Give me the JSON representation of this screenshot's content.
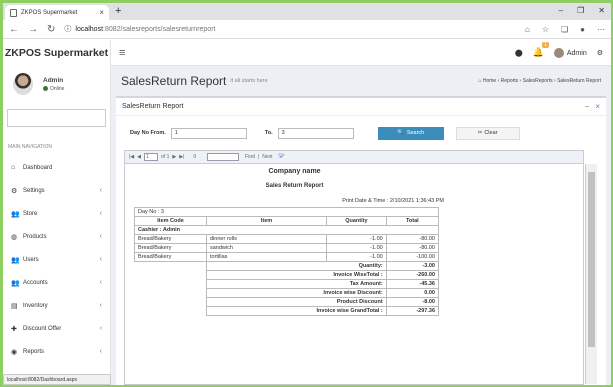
{
  "browser": {
    "tab_title": "ZKPOS Supermarket",
    "url_host": "localhost",
    "url_rest": ":8082/salesreports/salesreturnreport",
    "status_url": "localhost:8082/Dashboard.aspx"
  },
  "app": {
    "brand": "ZKPOS Supermarket",
    "user_name": "Admin",
    "user_status": "Online",
    "topbar_user": "Admin",
    "notification_count": "1"
  },
  "sidebar": {
    "header": "MAIN NAVIGATION",
    "items": [
      {
        "label": "Dashboard",
        "icon": "dashboard-icon"
      },
      {
        "label": "Settings",
        "icon": "gear-icon"
      },
      {
        "label": "Store",
        "icon": "users-icon"
      },
      {
        "label": "Products",
        "icon": "products-icon"
      },
      {
        "label": "Users",
        "icon": "users-icon"
      },
      {
        "label": "Accounts",
        "icon": "users-icon"
      },
      {
        "label": "Inventory",
        "icon": "inventory-icon"
      },
      {
        "label": "Discount Offer",
        "icon": "plus-icon"
      },
      {
        "label": "Reports",
        "icon": "reports-icon"
      }
    ]
  },
  "page": {
    "title": "SalesReturn Report",
    "subtitle": "it all starts here",
    "breadcrumb": [
      "Home",
      "Reports",
      "SalesReports",
      "SalesReturn Report"
    ],
    "box_title": "SalesReturn Report"
  },
  "filters": {
    "from_label": "Day No From.",
    "from_value": "1",
    "to_label": "To.",
    "to_value": "3",
    "search_label": "Search",
    "clear_label": "Clear"
  },
  "viewer": {
    "page_current": "1",
    "page_total": "of 1",
    "zoom": "0",
    "find_label": "Find",
    "next_label": "Next"
  },
  "report": {
    "company": "Company name",
    "title": "Sales Return Report",
    "print_date": "Print Date & Time : 2/10/2021 1:36:43 PM",
    "day_no": "Day No : 3",
    "columns": [
      "Item Code",
      "Item",
      "Quantity",
      "Total"
    ],
    "cashier": "Cashier : Admin",
    "rows": [
      {
        "code": "Bread/Bakery",
        "item": "dinner rolls",
        "qty": "-1.00",
        "total": "-80.00"
      },
      {
        "code": "Bread/Bakery",
        "item": "sandwich",
        "qty": "-1.00",
        "total": "-80.00"
      },
      {
        "code": "Bread/Bakery",
        "item": "tortillas",
        "qty": "-1.00",
        "total": "-100.00"
      }
    ],
    "summary": [
      {
        "label": "Quantity:",
        "value": "-3.00"
      },
      {
        "label": "Invoice WiseTotal :",
        "value": "-260.00"
      },
      {
        "label": "Tax Amount:",
        "value": "-45.36"
      },
      {
        "label": "Invoice wise Discount:",
        "value": "0.00"
      },
      {
        "label": "Product Discount",
        "value": "-8.00"
      },
      {
        "label": "Invoice wise GrandTotal :",
        "value": "-297.36"
      }
    ]
  }
}
